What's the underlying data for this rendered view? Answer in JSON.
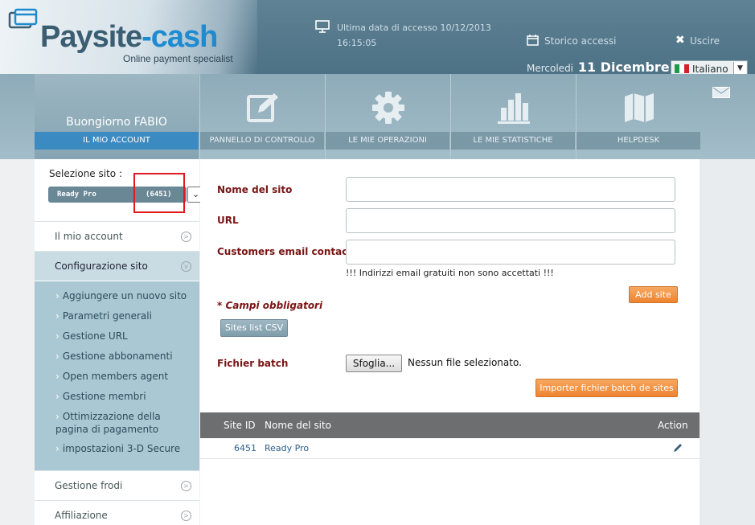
{
  "header": {
    "logo": {
      "part1": "Paysite",
      "part2": "-cash",
      "tagline": "Online payment specialist"
    },
    "last_access_label": "Ultima data di accesso 10/12/2013",
    "last_access_time": "16:15:05",
    "history_label": "Storico accessi",
    "logout_label": "Uscire",
    "date_weekday": "Mercoledi",
    "date_day": "11 Dicembre",
    "language": "Italiano"
  },
  "nav": {
    "greeting": "Buongiorno FABIO",
    "account_tab": "IL MIO ACCOUNT",
    "tabs": [
      {
        "label": "PANNELLO DI CONTROLLO",
        "icon": "edit-icon"
      },
      {
        "label": "LE MIE OPERAZIONI",
        "icon": "gear-icon"
      },
      {
        "label": "LE MIE STATISTICHE",
        "icon": "bar-chart-icon"
      },
      {
        "label": "HELPDESK",
        "icon": "map-icon"
      }
    ]
  },
  "sidebar": {
    "site_select_label": "Selezione sito :",
    "selected_site_name": "Ready Pro",
    "selected_site_code": "(6451)",
    "menu": {
      "my_account": "Il mio account",
      "site_config": "Configurazione sito",
      "fraud": "Gestione frodi",
      "affiliation": "Affiliazione"
    },
    "submenu": [
      "Aggiungere un nuovo sito",
      "Parametri generali",
      "Gestione URL",
      "Gestione abbonamenti",
      "Open members agent",
      "Gestione membri",
      "Ottimizzazione della pagina di pagamento",
      "impostazioni 3-D Secure"
    ]
  },
  "form": {
    "site_name_label": "Nome del sito",
    "url_label": "URL",
    "email_label": "Customers email contact",
    "email_note": "!!! Indirizzi email gratuiti non sono accettati !!!",
    "add_site_button": "Add site",
    "required_note": "* Campi obbligatori",
    "sites_csv_button": "Sites list CSV",
    "batch_label": "Fichier batch",
    "browse_button": "Sfoglia...",
    "no_file": "Nessun file selezionato.",
    "import_button": "Importer fichier batch de sites"
  },
  "table": {
    "headers": {
      "site_id": "Site ID",
      "site_name": "Nome del sito",
      "action": "Action"
    },
    "rows": [
      {
        "site_id": "6451",
        "site_name": "Ready Pro"
      }
    ]
  },
  "colors": {
    "brand_blue": "#1e8ad0",
    "accent_orange": "#ee8430",
    "header_bg": "#5f8294",
    "active_tab": "#3c8ac2"
  }
}
